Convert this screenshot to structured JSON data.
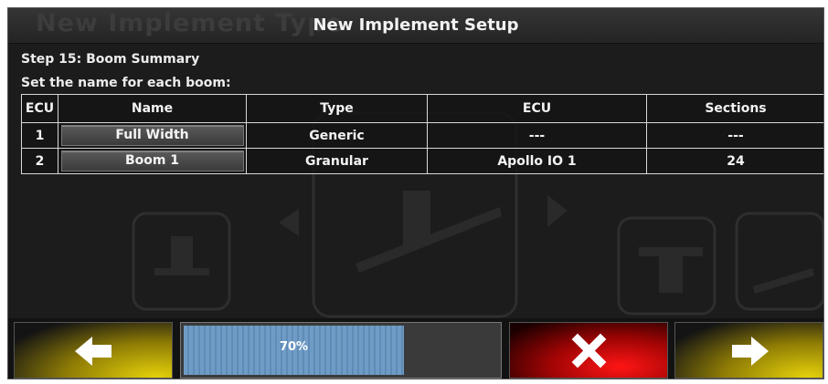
{
  "header": {
    "background_title": "New Implement Type",
    "title": "New Implement Setup"
  },
  "content": {
    "step": "Step 15: Boom Summary",
    "instruction": "Set the name for each boom:"
  },
  "table": {
    "columns": [
      "ECU",
      "Name",
      "Type",
      "ECU",
      "Sections"
    ],
    "rows": [
      {
        "ecu": "1",
        "name": "Full Width",
        "type": "Generic",
        "ecu_name": "---",
        "sections": "---"
      },
      {
        "ecu": "2",
        "name": "Boom 1",
        "type": "Granular",
        "ecu_name": "Apollo  IO 1",
        "sections": "24"
      }
    ]
  },
  "footer": {
    "back_icon": "arrow-left-icon",
    "cancel_icon": "close-icon",
    "next_icon": "arrow-right-icon",
    "progress": {
      "percent": 70,
      "label": "70%"
    }
  },
  "colors": {
    "accent_yellow": "#e5d20a",
    "cancel_red": "#ff1515",
    "progress_blue": "#6f9cc6"
  }
}
